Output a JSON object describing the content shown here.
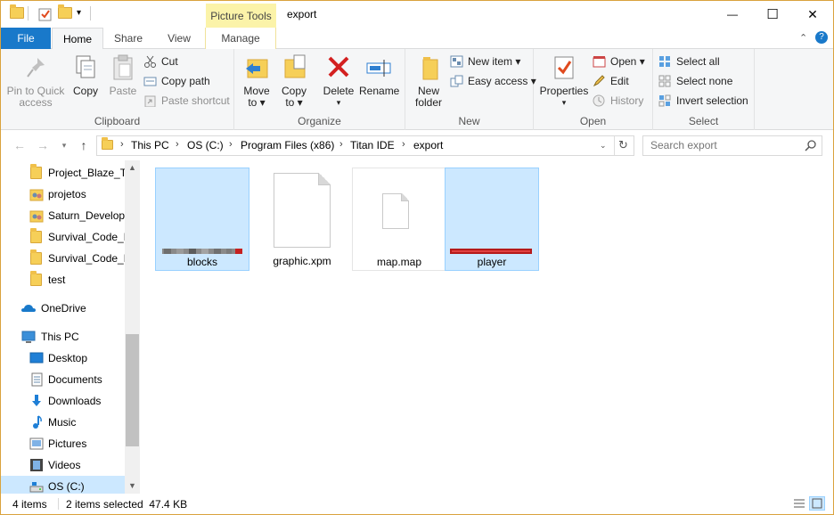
{
  "window": {
    "title": "export",
    "contextual_tab": "Picture Tools",
    "minimize_glyph": "—",
    "maximize_glyph": "☐",
    "close_glyph": "✕"
  },
  "tabs": {
    "file": "File",
    "home": "Home",
    "share": "Share",
    "view": "View",
    "manage": "Manage"
  },
  "ribbon": {
    "clipboard": {
      "label": "Clipboard",
      "pin_line1": "Pin to Quick",
      "pin_line2": "access",
      "copy": "Copy",
      "paste": "Paste",
      "cut": "Cut",
      "copy_path": "Copy path",
      "paste_shortcut": "Paste shortcut"
    },
    "organize": {
      "label": "Organize",
      "move_line1": "Move",
      "move_line2": "to",
      "copy_line1": "Copy",
      "copy_line2": "to",
      "delete": "Delete",
      "rename": "Rename"
    },
    "new": {
      "label": "New",
      "new_folder_line1": "New",
      "new_folder_line2": "folder",
      "new_item": "New item",
      "easy_access": "Easy access"
    },
    "open": {
      "label": "Open",
      "properties": "Properties",
      "open": "Open",
      "edit": "Edit",
      "history": "History"
    },
    "select": {
      "label": "Select",
      "select_all": "Select all",
      "select_none": "Select none",
      "invert_selection": "Invert selection"
    }
  },
  "address": {
    "crumbs": [
      "This PC",
      "OS (C:)",
      "Program Files (x86)",
      "Titan IDE",
      "export"
    ],
    "search_placeholder": "Search export"
  },
  "navpane": {
    "quick_items": [
      "Project_Blaze_Tra",
      "projetos",
      "Saturn_Developr",
      "Survival_Code_B",
      "Survival_Code_D",
      "test"
    ],
    "onedrive": "OneDrive",
    "this_pc": "This PC",
    "pc_items": [
      "Desktop",
      "Documents",
      "Downloads",
      "Music",
      "Pictures",
      "Videos",
      "OS (C:)"
    ]
  },
  "files": [
    {
      "name": "blocks",
      "selected": true,
      "kind": "image"
    },
    {
      "name": "graphic.xpm",
      "selected": false,
      "kind": "document"
    },
    {
      "name": "map.map",
      "selected": false,
      "kind": "document"
    },
    {
      "name": "player",
      "selected": true,
      "kind": "image"
    }
  ],
  "status": {
    "item_count": "4 items",
    "selection": "2 items selected  47.4 KB"
  },
  "colors": {
    "accent": "#1979ca",
    "selection": "#cce8ff",
    "contextual": "#fbf3a9"
  }
}
